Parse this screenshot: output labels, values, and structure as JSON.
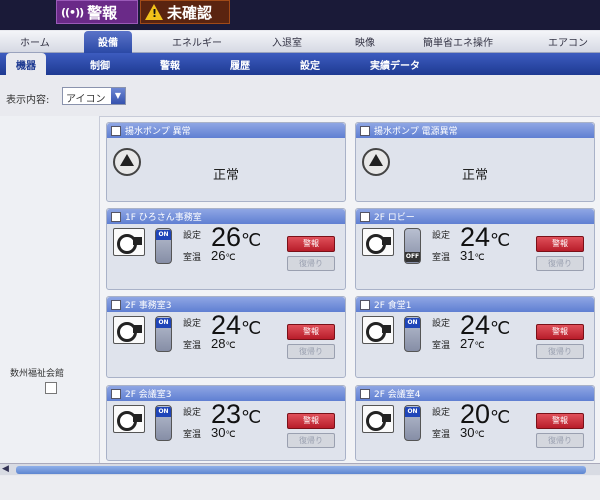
{
  "alarm_bar": {
    "alarm_label": "警報",
    "alarm_wave": "((•))",
    "unack_label": "未確認"
  },
  "main_tabs": [
    {
      "label": "ホーム"
    },
    {
      "label": "設備"
    },
    {
      "label": "エネルギー"
    },
    {
      "label": "入退室"
    },
    {
      "label": "映像"
    },
    {
      "label": "簡単省エネ操作"
    },
    {
      "label": "エアコン"
    }
  ],
  "sub_tabs": [
    {
      "label": "機器"
    },
    {
      "label": "制御"
    },
    {
      "label": "警報"
    },
    {
      "label": "履歴"
    },
    {
      "label": "設定"
    },
    {
      "label": "実績データ"
    }
  ],
  "display": {
    "label": "表示内容:",
    "selected": "アイコン"
  },
  "group": {
    "label": "数州福祉会館"
  },
  "panels": [
    {
      "title": "揚水ポンプ 異常",
      "status": "正常"
    },
    {
      "title": "揚水ポンプ 電源異常",
      "status": "正常"
    },
    {
      "title": "1F ひろさん事務室",
      "set_label": "設定",
      "room_label": "室温",
      "set_temp": "26",
      "room_temp": "26",
      "unit": "℃",
      "onoff": "ON",
      "alarm_btn": "警報",
      "restore_btn": "復帰り"
    },
    {
      "title": "2F ロビー",
      "set_label": "設定",
      "room_label": "室温",
      "set_temp": "24",
      "room_temp": "31",
      "unit": "℃",
      "onoff": "OFF",
      "alarm_btn": "警報",
      "restore_btn": "復帰り"
    },
    {
      "title": "2F 事務室3",
      "set_label": "設定",
      "room_label": "室温",
      "set_temp": "24",
      "room_temp": "28",
      "unit": "℃",
      "onoff": "ON",
      "alarm_btn": "警報",
      "restore_btn": "復帰り"
    },
    {
      "title": "2F 食堂1",
      "set_label": "設定",
      "room_label": "室温",
      "set_temp": "24",
      "room_temp": "27",
      "unit": "℃",
      "onoff": "ON",
      "alarm_btn": "警報",
      "restore_btn": "復帰り"
    },
    {
      "title": "2F 会議室3",
      "set_label": "設定",
      "room_label": "室温",
      "set_temp": "23",
      "room_temp": "30",
      "unit": "℃",
      "onoff": "ON",
      "alarm_btn": "警報",
      "restore_btn": "復帰り"
    },
    {
      "title": "2F 会議室4",
      "set_label": "設定",
      "room_label": "室温",
      "set_temp": "20",
      "room_temp": "30",
      "unit": "℃",
      "onoff": "ON",
      "alarm_btn": "警報",
      "restore_btn": "復帰り"
    }
  ],
  "scrollbar": {
    "left_arrow": "◀"
  }
}
